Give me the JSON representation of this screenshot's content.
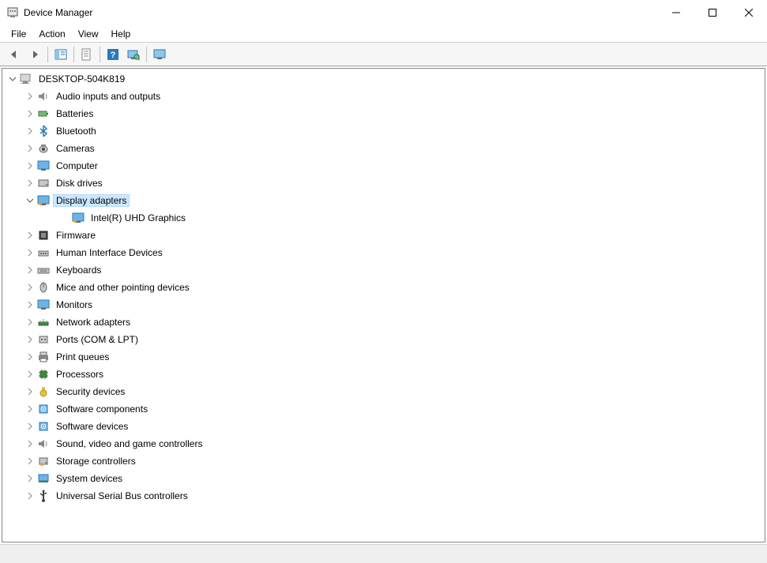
{
  "window": {
    "title": "Device Manager"
  },
  "menubar": {
    "items": [
      "File",
      "Action",
      "View",
      "Help"
    ]
  },
  "toolbar": {
    "buttons": [
      {
        "name": "back-button",
        "icon": "arrow-left"
      },
      {
        "name": "forward-button",
        "icon": "arrow-right"
      },
      {
        "name": "show-hide-button",
        "icon": "tree-panel"
      },
      {
        "name": "properties-button",
        "icon": "properties"
      },
      {
        "name": "help-button",
        "icon": "help"
      },
      {
        "name": "scan-button",
        "icon": "scan"
      },
      {
        "name": "monitor-button",
        "icon": "monitor"
      }
    ]
  },
  "tree": {
    "root": {
      "label": "DESKTOP-504K819",
      "icon": "computer",
      "expanded": true,
      "children": [
        {
          "label": "Audio inputs and outputs",
          "icon": "audio",
          "expanded": false
        },
        {
          "label": "Batteries",
          "icon": "battery",
          "expanded": false
        },
        {
          "label": "Bluetooth",
          "icon": "bluetooth",
          "expanded": false
        },
        {
          "label": "Cameras",
          "icon": "camera",
          "expanded": false
        },
        {
          "label": "Computer",
          "icon": "monitor",
          "expanded": false
        },
        {
          "label": "Disk drives",
          "icon": "disk",
          "expanded": false
        },
        {
          "label": "Display adapters",
          "icon": "display",
          "expanded": true,
          "selected": true,
          "children": [
            {
              "label": "Intel(R) UHD Graphics",
              "icon": "display",
              "leaf": true
            }
          ]
        },
        {
          "label": "Firmware",
          "icon": "firmware",
          "expanded": false
        },
        {
          "label": "Human Interface Devices",
          "icon": "hid",
          "expanded": false
        },
        {
          "label": "Keyboards",
          "icon": "keyboard",
          "expanded": false
        },
        {
          "label": "Mice and other pointing devices",
          "icon": "mouse",
          "expanded": false
        },
        {
          "label": "Monitors",
          "icon": "monitor",
          "expanded": false
        },
        {
          "label": "Network adapters",
          "icon": "network",
          "expanded": false
        },
        {
          "label": "Ports (COM & LPT)",
          "icon": "port",
          "expanded": false
        },
        {
          "label": "Print queues",
          "icon": "printer",
          "expanded": false
        },
        {
          "label": "Processors",
          "icon": "cpu",
          "expanded": false
        },
        {
          "label": "Security devices",
          "icon": "security",
          "expanded": false
        },
        {
          "label": "Software components",
          "icon": "software",
          "expanded": false
        },
        {
          "label": "Software devices",
          "icon": "software",
          "expanded": false
        },
        {
          "label": "Sound, video and game controllers",
          "icon": "audio",
          "expanded": false
        },
        {
          "label": "Storage controllers",
          "icon": "storage",
          "expanded": false
        },
        {
          "label": "System devices",
          "icon": "system",
          "expanded": false
        },
        {
          "label": "Universal Serial Bus controllers",
          "icon": "usb",
          "expanded": false
        }
      ]
    }
  }
}
